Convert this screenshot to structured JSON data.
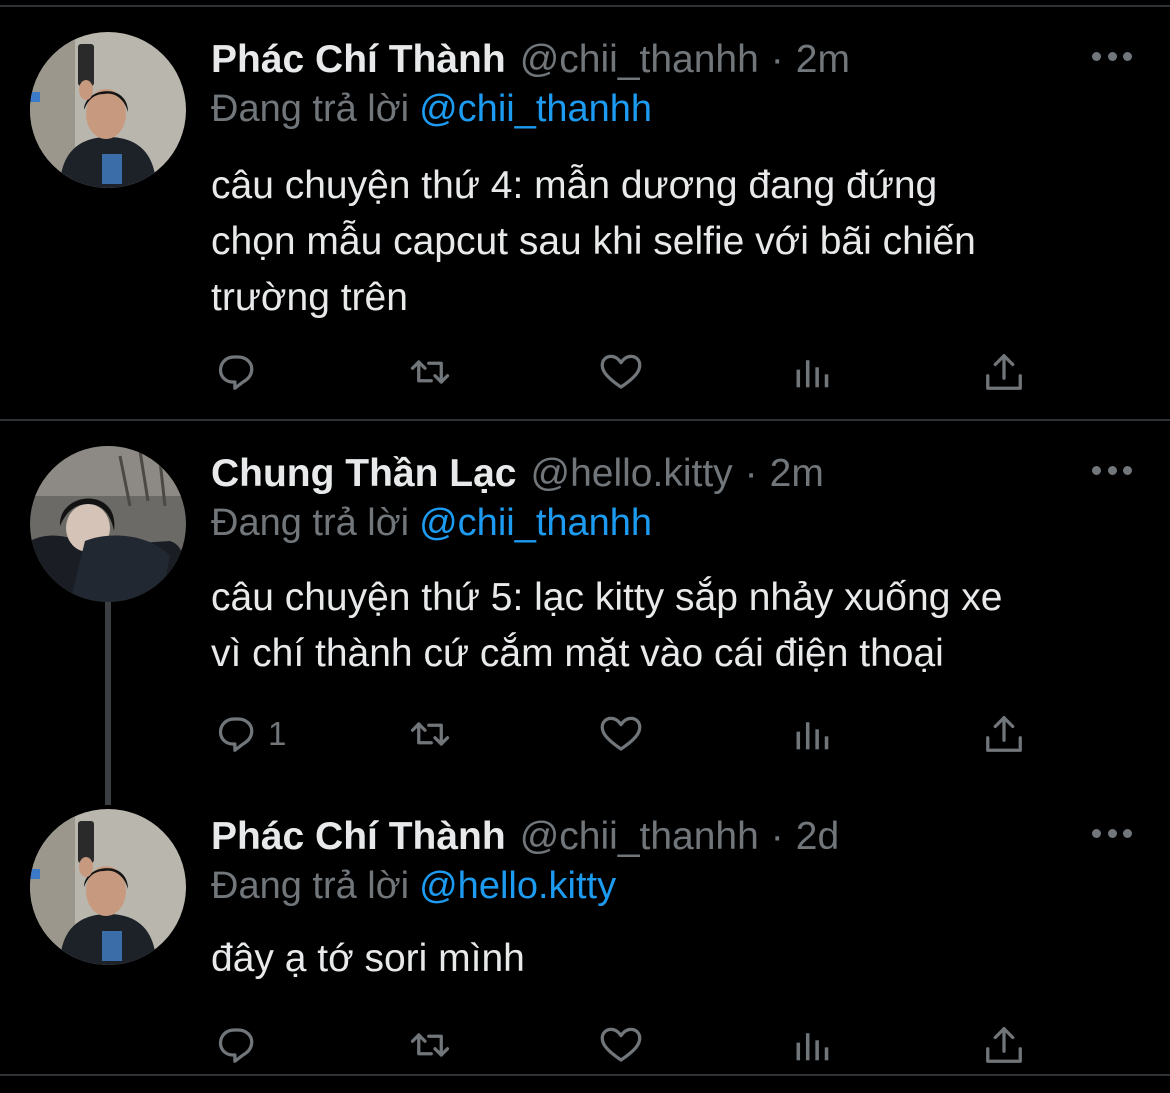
{
  "tweets": [
    {
      "display_name": "Phác Chí Thành",
      "handle": "@chii_thanhh",
      "dot": "·",
      "time": "2m",
      "replying_prefix": "Đang trả lời",
      "replying_to": "@chii_thanhh",
      "text": "câu chuyện thứ 4: mẫn dương đang đứng\nchọn mẫu capcut sau khi selfie với bãi chiến\ntrường trên",
      "reply_count": ""
    },
    {
      "display_name": "Chung Thần Lạc",
      "handle": "@hello.kitty",
      "dot": "·",
      "time": "2m",
      "replying_prefix": "Đang trả lời",
      "replying_to": "@chii_thanhh",
      "text": "câu chuyện thứ 5: lạc kitty sắp nhảy xuống xe\nvì chí thành cứ cắm mặt vào cái điện thoại",
      "reply_count": "1"
    },
    {
      "display_name": "Phác Chí Thành",
      "handle": "@chii_thanhh",
      "dot": "·",
      "time": "2d",
      "replying_prefix": "Đang trả lời",
      "replying_to": "@hello.kitty",
      "text": "đây ạ tớ sori mình",
      "reply_count": ""
    }
  ],
  "icons": {
    "reply": "reply-icon",
    "retweet": "retweet-icon",
    "like": "heart-icon",
    "views": "analytics-icon",
    "share": "share-icon",
    "more": "more-icon"
  },
  "colors": {
    "background": "#000000",
    "text": "#e7e9ea",
    "muted": "#71767b",
    "mention": "#1d9bf0",
    "divider": "#2f3336"
  }
}
